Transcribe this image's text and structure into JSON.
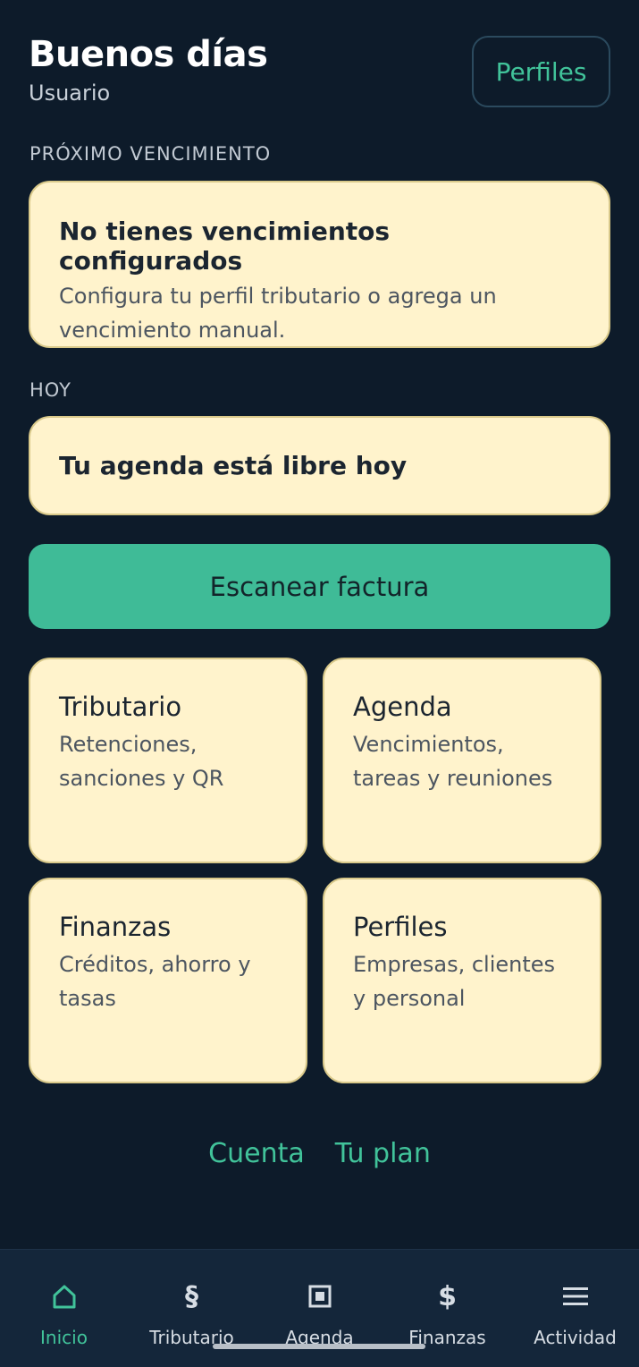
{
  "header": {
    "greeting": "Buenos días",
    "user": "Usuario",
    "profiles_button": "Perfiles"
  },
  "next_due": {
    "label": "PRÓXIMO VENCIMIENTO",
    "title": "No tienes vencimientos configurados",
    "body": "Configura tu perfil tributario o agrega un vencimiento manual."
  },
  "today": {
    "label": "HOY",
    "text": "Tu agenda está libre hoy"
  },
  "scan_button": "Escanear factura",
  "tiles": [
    {
      "title": "Tributario",
      "subtitle": "Retenciones, sanciones y QR"
    },
    {
      "title": "Agenda",
      "subtitle": "Vencimientos, tareas y reuniones"
    },
    {
      "title": "Finanzas",
      "subtitle": "Créditos, ahorro y tasas"
    },
    {
      "title": "Perfiles",
      "subtitle": "Empresas, clientes y personal"
    }
  ],
  "links": {
    "account": "Cuenta",
    "plan": "Tu plan"
  },
  "nav": [
    {
      "label": "Inicio",
      "icon": "home-icon",
      "active": true
    },
    {
      "label": "Tributario",
      "icon": "section-icon"
    },
    {
      "label": "Agenda",
      "icon": "calendar-square-icon"
    },
    {
      "label": "Finanzas",
      "icon": "dollar-icon"
    },
    {
      "label": "Actividad",
      "icon": "menu-icon"
    }
  ],
  "colors": {
    "background": "#0d1b2a",
    "card": "#fff3cc",
    "accent": "#41c39a",
    "scan_button": "#3fbb97",
    "nav_background": "#14263a"
  }
}
